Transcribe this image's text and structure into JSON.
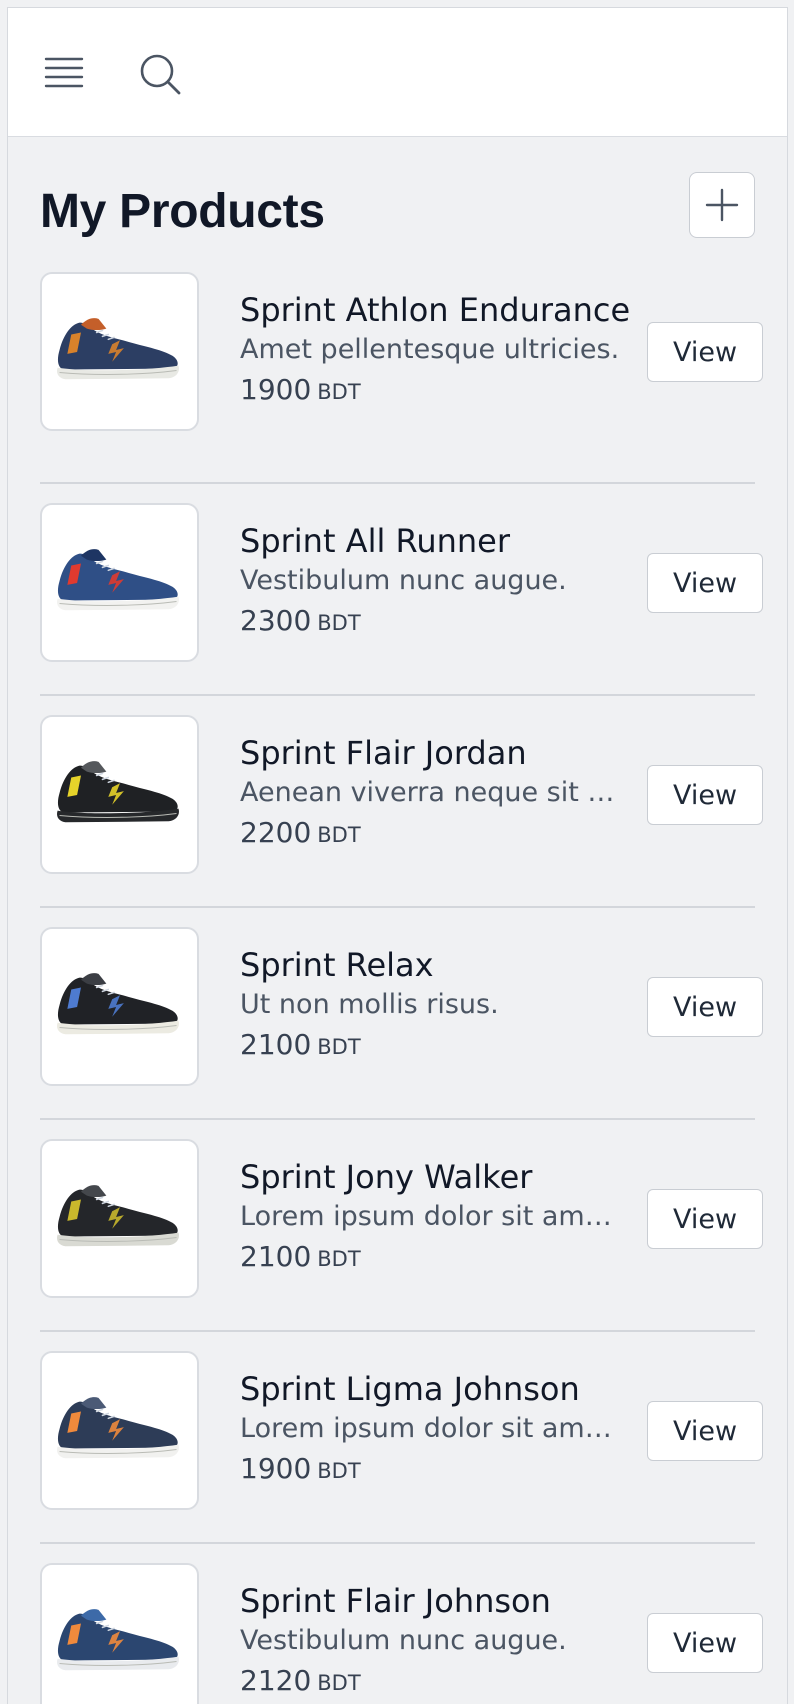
{
  "header": {
    "menu_icon": "hamburger-menu-icon",
    "search_icon": "search-icon"
  },
  "page": {
    "title": "My Products",
    "add_icon": "plus-icon"
  },
  "products": [
    {
      "name": "Sprint Athlon Endurance",
      "description": "Amet pellentesque ultricies.",
      "price": "1900",
      "currency": "BDT",
      "view_label": "View",
      "shoe": {
        "upper": "#2c3e63",
        "sole": "#e8e9e4",
        "accent": "#d9822b",
        "accent2": "#c45f2a"
      }
    },
    {
      "name": "Sprint All Runner",
      "description": "Vestibulum nunc augue.",
      "price": "2300",
      "currency": "BDT",
      "view_label": "View",
      "shoe": {
        "upper": "#2f4f86",
        "sole": "#f2f2f0",
        "accent": "#e03a2f",
        "accent2": "#1e3563"
      }
    },
    {
      "name": "Sprint Flair Jordan",
      "description": "Aenean viverra neque sit amet.",
      "price": "2200",
      "currency": "BDT",
      "view_label": "View",
      "shoe": {
        "upper": "#1f2124",
        "sole": "#26282b",
        "accent": "#e6d32a",
        "accent2": "#55585c"
      }
    },
    {
      "name": "Sprint Relax",
      "description": "Ut non mollis risus.",
      "price": "2100",
      "currency": "BDT",
      "view_label": "View",
      "shoe": {
        "upper": "#202226",
        "sole": "#ecebe2",
        "accent": "#4e7bd0",
        "accent2": "#3b3e44"
      }
    },
    {
      "name": "Sprint Jony Walker",
      "description": "Lorem ipsum dolor sit amet, consectetur.",
      "price": "2100",
      "currency": "BDT",
      "view_label": "View",
      "shoe": {
        "upper": "#24262a",
        "sole": "#d9dad3",
        "accent": "#c9b82c",
        "accent2": "#44474c"
      }
    },
    {
      "name": "Sprint Ligma Johnson",
      "description": "Lorem ipsum dolor sit amet.",
      "price": "1900",
      "currency": "BDT",
      "view_label": "View",
      "shoe": {
        "upper": "#2d3c57",
        "sole": "#f1f1ef",
        "accent": "#f08a3c",
        "accent2": "#4b5a76"
      }
    },
    {
      "name": "Sprint Flair Johnson",
      "description": "Vestibulum nunc augue.",
      "price": "2120",
      "currency": "BDT",
      "view_label": "View",
      "shoe": {
        "upper": "#2b4670",
        "sole": "#e9ebee",
        "accent": "#f08a3c",
        "accent2": "#3d6aa8"
      }
    }
  ]
}
